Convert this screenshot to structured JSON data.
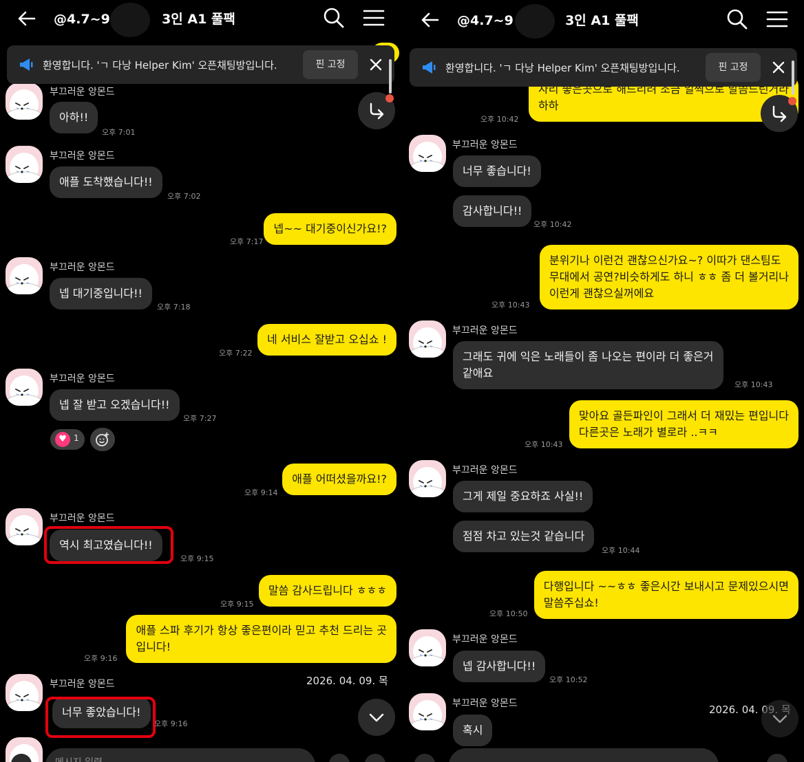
{
  "chat": {
    "title_prefix": "@4.7~9",
    "title_suffix": "3인 A1 풀팩",
    "notice": "환영합니다. 'ㄱ 다낭 Helper Kim' 오픈채팅방입니다.",
    "pin_label": "핀 고정",
    "sender": "부끄러운 앙몬드",
    "input_placeholder": "메시지 입력",
    "date_label": "2026. 04. 09. 목"
  },
  "left": {
    "messages": [
      {
        "text": "아하!!",
        "time": "오후 7:01"
      },
      {
        "text": "애플 도착했습니다!!",
        "time": "오후 7:02"
      },
      {
        "text": "넵~~ 대기중이신가요!?",
        "time": "오후 7:17"
      },
      {
        "text": "넵 대기중입니다!!",
        "time": "오후 7:18"
      },
      {
        "text": "네 서비스 잘받고 오십쇼 !",
        "time": "오후 7:22"
      },
      {
        "text": "넵 잘 받고 오겠습니다!!",
        "time": "오후 7:27"
      },
      {
        "text": "애플 어떠셨을까요!?",
        "time": "오후 9:14"
      },
      {
        "text": "역시 최고였습니다!!",
        "time": "오후 9:15"
      },
      {
        "text": "말씀 감사드립니다 ㅎㅎㅎ",
        "time": "오후 9:15"
      },
      {
        "line1": "애플 스파 후기가 항상 좋은편이라 믿고 추천 드리는 곳",
        "line2": "입니다!",
        "time": "오후 9:16"
      },
      {
        "text": "너무 좋았습니다!",
        "time": "오후 9:16"
      }
    ],
    "reaction": {
      "emoji": "♥",
      "count": "1"
    }
  },
  "right": {
    "messages": [
      {
        "line1": "자리 좋은곳으로 해드리려 조금 일찍으로 말씀드린거라",
        "line2": "하하",
        "time": "오후 10:42"
      },
      {
        "text": "너무 좋습니다!"
      },
      {
        "text": "감사합니다!!",
        "time": "오후 10:42"
      },
      {
        "line1": "분위기나 이런건 괜찮으신가요~? 이따가 댄스팀도",
        "line2": "무대에서 공연?비슷하게도 하니 ㅎㅎ 좀 더 볼거리나",
        "line3": "이런게 괜찮으실꺼에요",
        "time": "오후 10:43"
      },
      {
        "line1": "그래도 귀에 익은 노래들이 좀 나오는 편이라 더 좋은거",
        "line2": "같애요",
        "time": "오후 10:43"
      },
      {
        "line1": "맞아요 골든파인이 그래서 더 재밌는 편입니다",
        "line2": "다른곳은 노래가 별로라 ..ㅋㅋ",
        "time": "오후 10:43"
      },
      {
        "text": "그게 제일 중요하죠 사실!!"
      },
      {
        "text": "점점 차고 있는것 같습니다",
        "time": "오후 10:44"
      },
      {
        "line1": "다행입니다 ~~ㅎㅎ 좋은시간 보내시고 문제있으시면",
        "line2": "말씀주십쇼!",
        "time": "오후 10:50"
      },
      {
        "text": "넵 감사합니다!!",
        "time": "오후 10:52"
      },
      {
        "text": "혹시"
      }
    ]
  },
  "colors": {
    "sent_bubble": "#fee500",
    "received_bubble": "#2f2f2f",
    "background": "#000000",
    "highlight": "#e3000f",
    "accent_icon": "#2f8cf0"
  }
}
